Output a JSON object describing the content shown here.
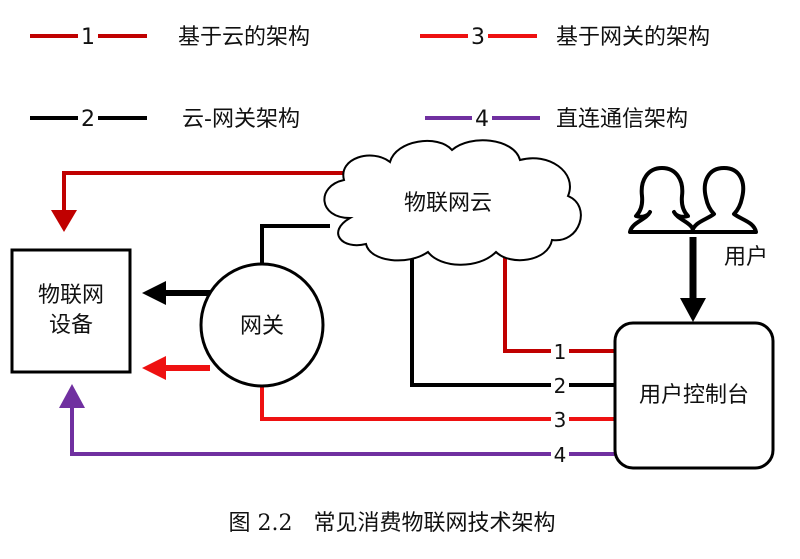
{
  "legend": [
    {
      "num": "1",
      "label": "基于云的架构",
      "color": "#c00000"
    },
    {
      "num": "3",
      "label": "基于网关的架构",
      "color": "#ee1111"
    },
    {
      "num": "2",
      "label": "云-网关架构",
      "color": "#000000"
    },
    {
      "num": "4",
      "label": "直连通信架构",
      "color": "#7030a0"
    }
  ],
  "nodes": {
    "device": "物联网\n设备",
    "device_line1": "物联网",
    "device_line2": "设备",
    "cloud": "物联网云",
    "gateway": "网关",
    "user": "用户",
    "console": "用户控制台"
  },
  "connections": [
    {
      "num": "1",
      "from": "console",
      "to": "cloud",
      "color": "#c00000"
    },
    {
      "num": "2",
      "from": "console",
      "to": "cloud",
      "color": "#000000"
    },
    {
      "num": "3",
      "from": "console",
      "to": "gateway",
      "color": "#ee1111"
    },
    {
      "num": "4",
      "from": "console",
      "to": "device",
      "color": "#7030a0"
    }
  ],
  "caption": "图 2.2   常见消费物联网技术架构",
  "icons": [
    "user-silhouette-icon"
  ]
}
